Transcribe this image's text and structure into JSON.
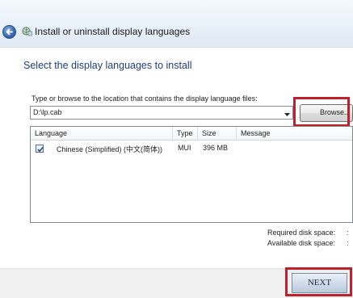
{
  "window": {
    "title": "Install or uninstall display languages",
    "back_icon": "back-arrow-icon",
    "app_icon": "globe-icon"
  },
  "main": {
    "heading": "Select the display languages to install",
    "path_label": "Type or browse to the location that contains the display language files:",
    "path_value": "D:\\lp.cab",
    "browse_label": "Browse..."
  },
  "list": {
    "columns": [
      "Language",
      "Type",
      "Size",
      "Message"
    ],
    "rows": [
      {
        "checked": true,
        "language": "Chinese (Simplified) (中文(简体))",
        "type": "MUI",
        "size": "396 MB",
        "message": ""
      }
    ]
  },
  "disk": {
    "required_label": "Required disk space:",
    "available_label": "Available disk space:",
    "required_value": ":",
    "available_value": ":"
  },
  "footer": {
    "next_label": "NEXT"
  },
  "colors": {
    "heading": "#1c3f7a",
    "highlight_box": "#c0202a",
    "titlebar": "#e9f1f9"
  }
}
